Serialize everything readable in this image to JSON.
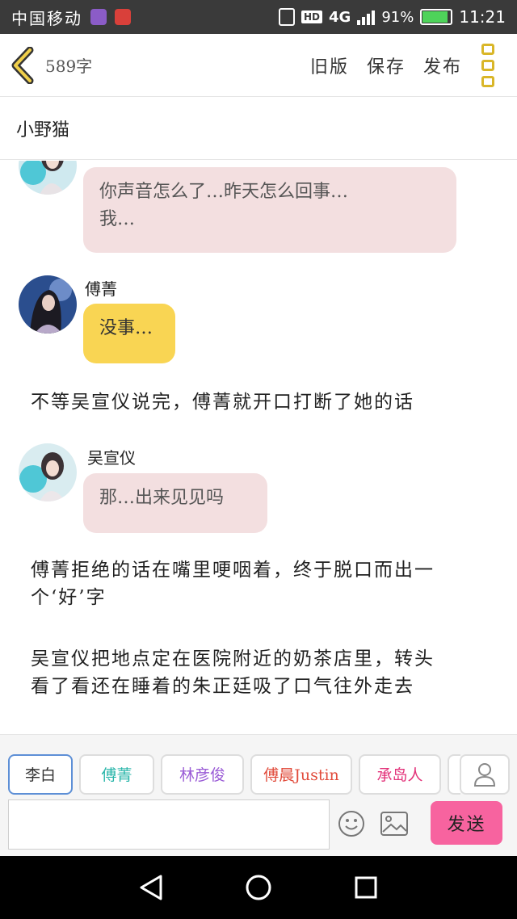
{
  "status_bar": {
    "carrier": "中国移动",
    "hd": "HD",
    "network": "4G",
    "battery_percent": "91%",
    "battery_level": 0.91,
    "time": "11:21"
  },
  "toolbar": {
    "word_count": "589字",
    "old_version": "旧版",
    "save": "保存",
    "publish": "发布"
  },
  "story_title": "小野猫",
  "messages": [
    {
      "type": "bubble",
      "sender": "",
      "text_line1": "你声音怎么了…昨天怎么回事…",
      "text_line2": "我…",
      "color": "#f3dfe0"
    },
    {
      "type": "bubble",
      "sender": "傅菁",
      "text": "没事…",
      "color": "#f9d553"
    },
    {
      "type": "narration",
      "text": "不等吴宣仪说完，傅菁就开口打断了她的话"
    },
    {
      "type": "bubble",
      "sender": "吴宣仪",
      "text": "那…出来见见吗",
      "color": "#f3dfe0"
    },
    {
      "type": "narration",
      "text_line1": "傅菁拒绝的话在嘴里哽咽着，终于脱口而出一",
      "text_line2": "个‘好’字"
    },
    {
      "type": "narration",
      "text_line1": "吴宣仪把地点定在医院附近的奶茶店里，转头",
      "text_line2": "看了看还在睡着的朱正廷吸了口气往外走去"
    }
  ],
  "characters": [
    {
      "name": "李白",
      "color": "#333333"
    },
    {
      "name": "傅菁",
      "color": "#27b5a9"
    },
    {
      "name": "林彦俊",
      "color": "#9a5bd6"
    },
    {
      "name": "傅晨Justin",
      "color": "#e14b3b"
    },
    {
      "name": "承岛人",
      "color": "#e3337a"
    }
  ],
  "compose": {
    "input_value": "",
    "send_label": "发送"
  },
  "colors": {
    "accent_yellow": "#d9b628",
    "send_pink": "#f7639f",
    "bubble_pink": "#f3dfe0",
    "bubble_yellow": "#f9d553"
  }
}
